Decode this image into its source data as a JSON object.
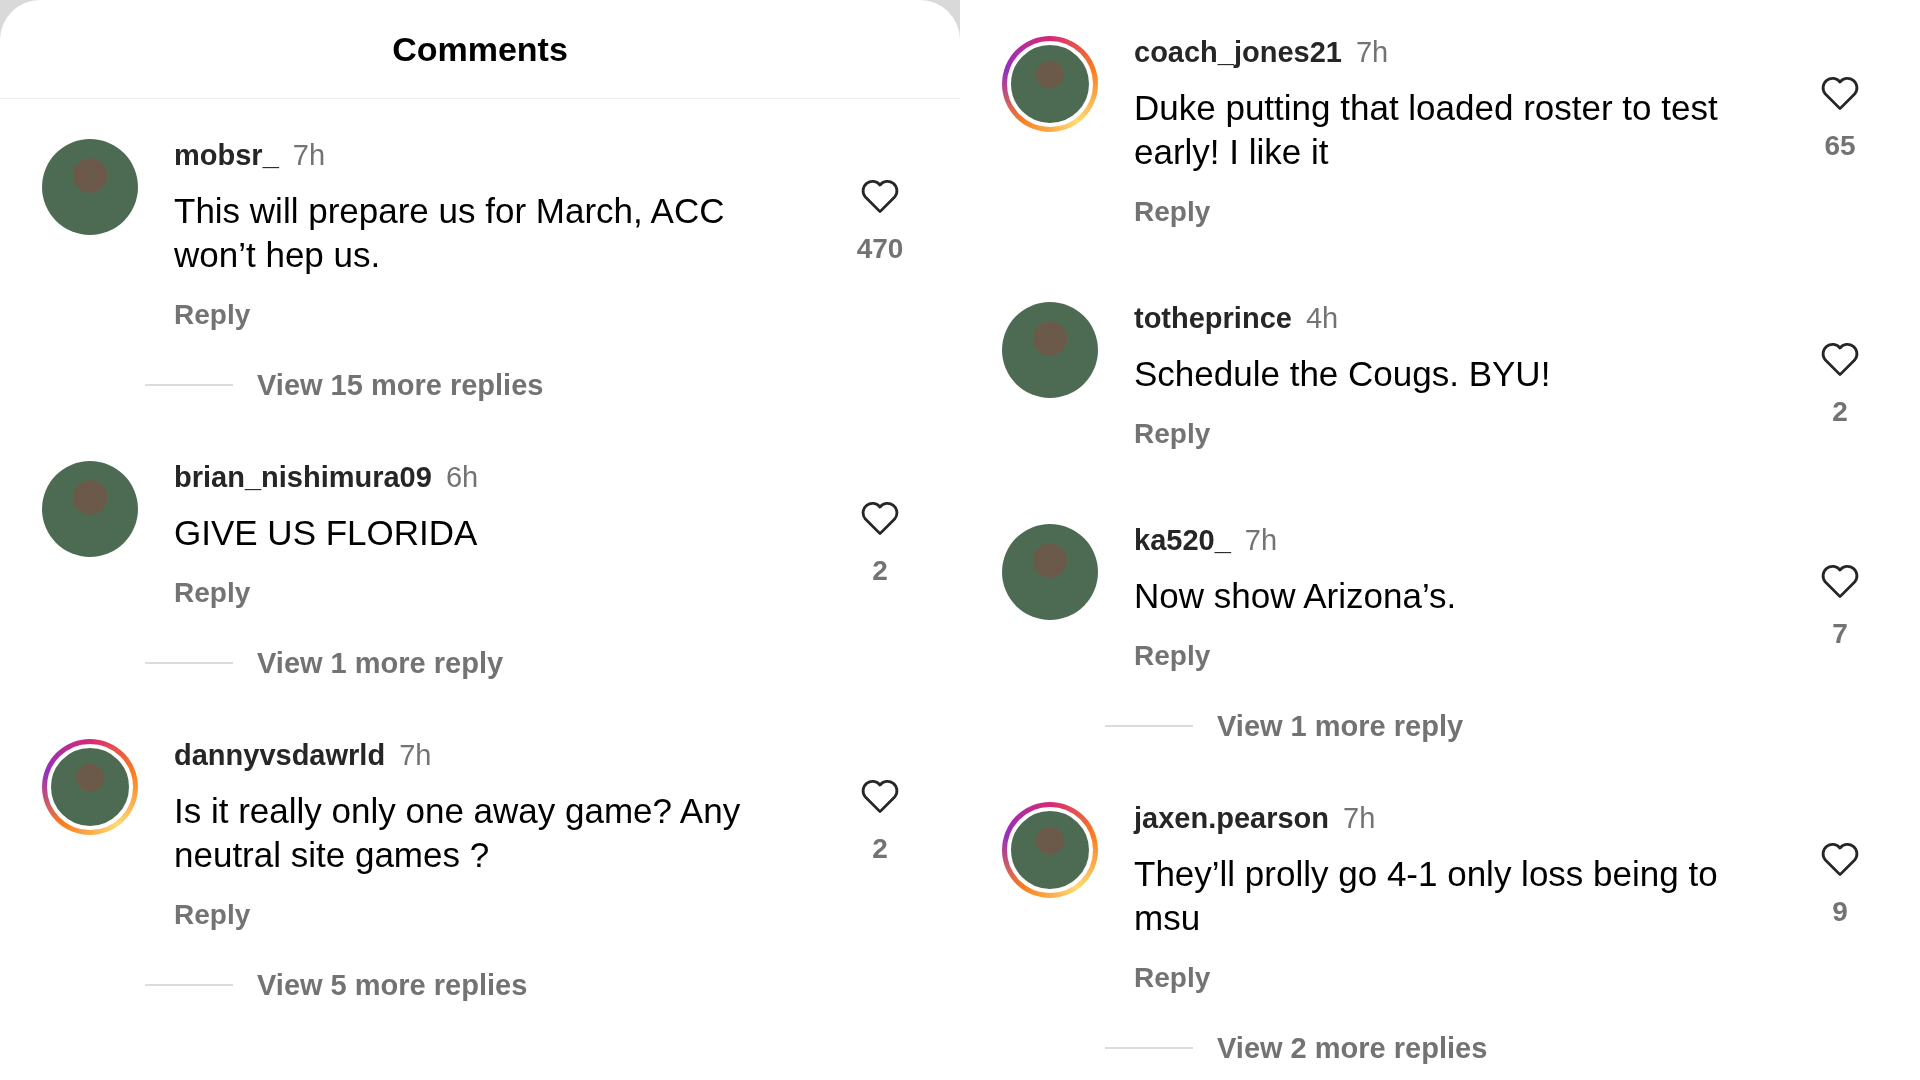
{
  "left_panel": {
    "title": "Comments",
    "comments": [
      {
        "username": "mobsr_",
        "time": "7h",
        "text": "This will prepare us for March, ACC won’t hep us.",
        "reply": "Reply",
        "likes": "470",
        "story_ring": false,
        "view_replies": "View 15 more replies"
      },
      {
        "username": "brian_nishimura09",
        "time": "6h",
        "text": "GIVE US FLORIDA",
        "reply": "Reply",
        "likes": "2",
        "story_ring": false,
        "view_replies": "View 1 more reply"
      },
      {
        "username": "dannyvsdawrld",
        "time": "7h",
        "text": "Is it really only one away game? Any neutral site games ?",
        "reply": "Reply",
        "likes": "2",
        "story_ring": true,
        "view_replies": "View 5 more replies"
      }
    ]
  },
  "right_panel": {
    "comments": [
      {
        "username": "coach_jones21",
        "time": "7h",
        "text": "Duke putting that loaded roster to test early! I like it",
        "reply": "Reply",
        "likes": "65",
        "story_ring": true
      },
      {
        "username": "totheprince",
        "time": "4h",
        "text": "Schedule the Cougs. BYU!",
        "reply": "Reply",
        "likes": "2",
        "story_ring": false
      },
      {
        "username": "ka520_",
        "time": "7h",
        "text": "Now show Arizona’s.",
        "reply": "Reply",
        "likes": "7",
        "story_ring": false,
        "view_replies": "View 1 more reply"
      },
      {
        "username": "jaxen.pearson",
        "time": "7h",
        "text": "They’ll prolly go 4-1 only loss being to msu",
        "reply": "Reply",
        "likes": "9",
        "story_ring": true,
        "view_replies": "View 2 more replies"
      }
    ]
  }
}
